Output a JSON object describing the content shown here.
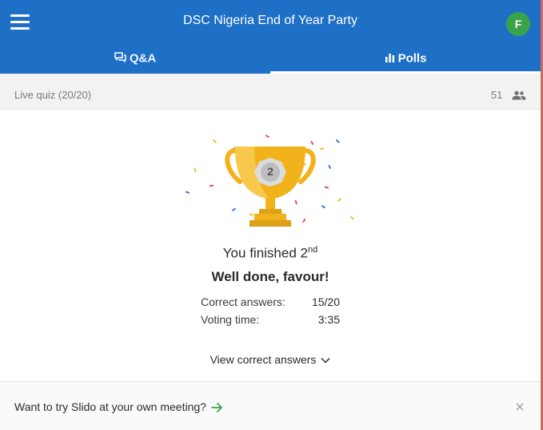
{
  "header": {
    "title": "DSC Nigeria End of Year Party",
    "avatar_letter": "F",
    "brand_color": "#1e6fc6",
    "avatar_color": "#3aa34a"
  },
  "tabs": [
    {
      "label": "Q&A",
      "icon": "chat-bubbles-icon",
      "active": false
    },
    {
      "label": "Polls",
      "icon": "bar-chart-icon",
      "active": true
    }
  ],
  "subbar": {
    "status": "Live quiz (20/20)",
    "participants_count": "51",
    "participants_icon": "people-icon"
  },
  "result": {
    "trophy_rank": "2",
    "finished_prefix": "You finished 2",
    "finished_suffix": "nd",
    "message": "Well done, favour!",
    "stats": [
      {
        "label": "Correct answers:",
        "value": "15/20"
      },
      {
        "label": "Voting time:",
        "value": "3:35"
      }
    ],
    "view_answers_label": "View correct answers"
  },
  "footer": {
    "promo_text": "Want to try Slido at your own meeting?",
    "arrow_color": "#3aa34a"
  }
}
